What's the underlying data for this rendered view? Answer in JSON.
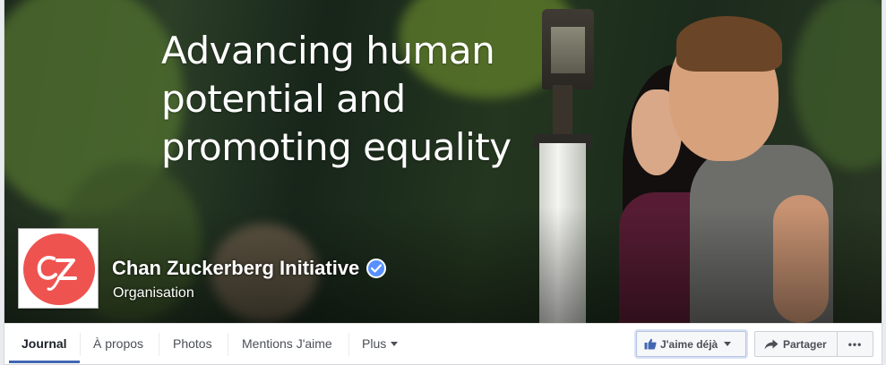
{
  "cover": {
    "headline_lines": [
      "Advancing human",
      "potential and",
      "promoting equality"
    ]
  },
  "page": {
    "name": "Chan Zuckerberg Initiative",
    "category": "Organisation",
    "verified": true,
    "logo_color": "#ef5350"
  },
  "tabs": [
    {
      "label": "Journal",
      "active": true
    },
    {
      "label": "À propos",
      "active": false
    },
    {
      "label": "Photos",
      "active": false
    },
    {
      "label": "Mentions J'aime",
      "active": false
    },
    {
      "label": "Plus",
      "active": false
    }
  ],
  "actions": {
    "like_label": "J'aime déjà",
    "share_label": "Partager",
    "more_label": "•••"
  },
  "colors": {
    "accent": "#4267b2",
    "verified": "#5890ff"
  },
  "icons": {
    "like": "thumbs-up-icon",
    "share": "share-arrow-icon",
    "verified": "verified-badge-icon"
  }
}
